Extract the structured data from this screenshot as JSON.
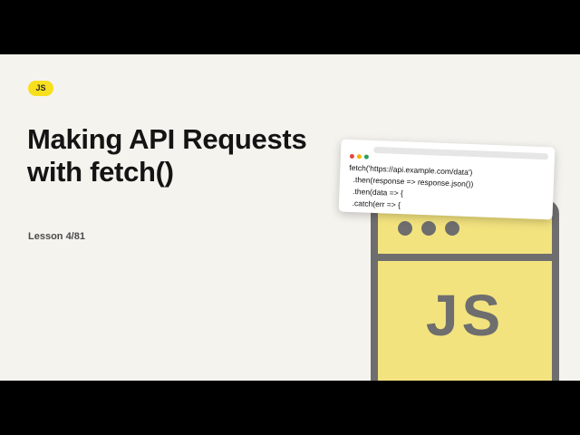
{
  "badge": {
    "label": "JS",
    "color": "#f7df1e"
  },
  "title": "Making API Requests with fetch()",
  "lesson": "Lesson 4/81",
  "logo": {
    "text": "JS",
    "fill": "#f3e37f",
    "stroke": "#6e6e6e"
  },
  "code_card": {
    "dot_colors": [
      "#e8453c",
      "#f4b400",
      "#2aa05a"
    ],
    "lines": [
      "fetch('https://api.example.com/data')",
      "  .then(response => response.json())",
      "  .then(data => {",
      "  .catch(err => {"
    ]
  }
}
